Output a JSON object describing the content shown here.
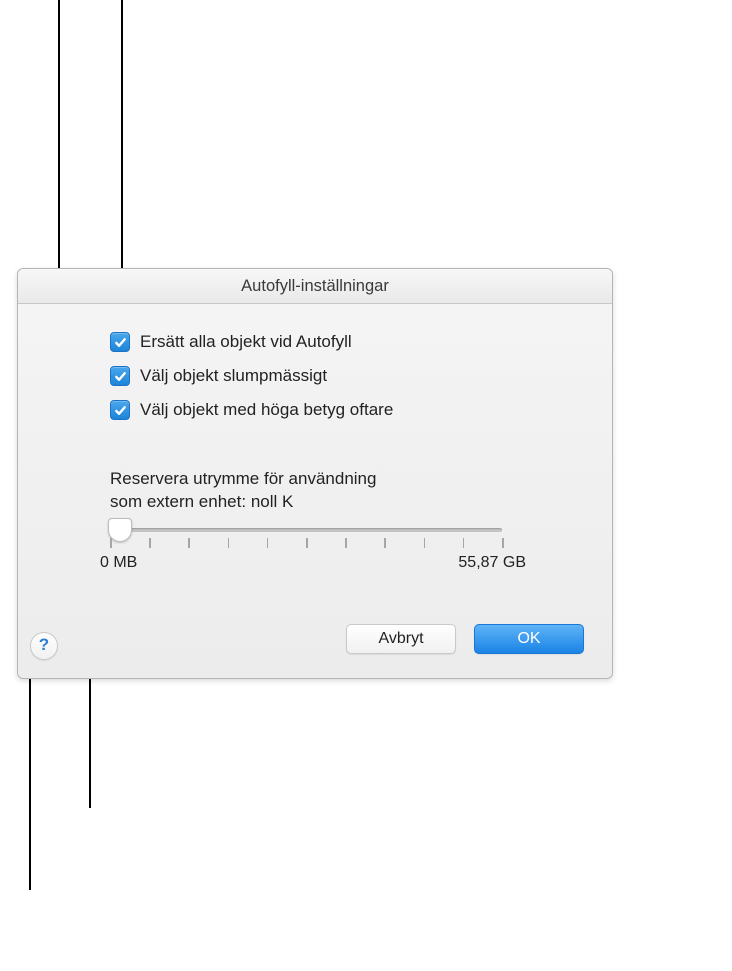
{
  "dialog": {
    "title": "Autofyll-inställningar",
    "checkboxes": [
      {
        "label": "Ersätt alla objekt vid Autofyll",
        "checked": true
      },
      {
        "label": "Välj objekt slumpmässigt",
        "checked": true
      },
      {
        "label": "Välj objekt med höga betyg oftare",
        "checked": true
      }
    ],
    "reserve": {
      "line1": "Reservera utrymme för användning",
      "line2_prefix": "som extern enhet:   ",
      "value": "noll K"
    },
    "slider": {
      "min_label": "0 MB",
      "max_label": "55,87 GB",
      "position_pct": 2.5,
      "tick_count": 11
    },
    "buttons": {
      "cancel": "Avbryt",
      "ok": "OK"
    },
    "help": "?"
  }
}
